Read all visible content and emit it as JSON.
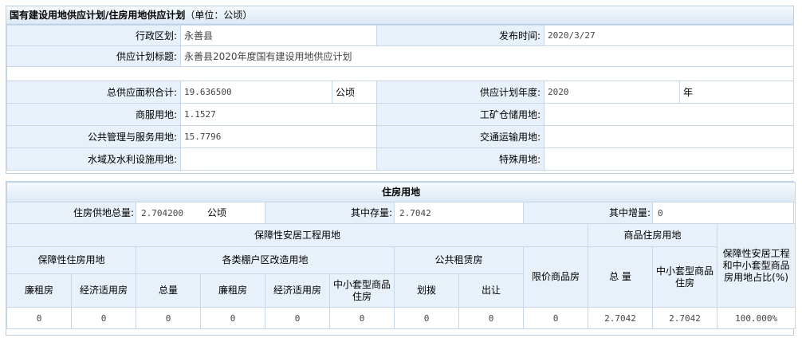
{
  "top": {
    "title": "国有建设用地供应计划/住房用地供应计划",
    "unit_note": "（单位：公顷）",
    "row1": {
      "district_label": "行政区划:",
      "district_value": "永善县",
      "pubtime_label": "发布时间:",
      "pubtime_value": "2020/3/27"
    },
    "row2": {
      "plan_title_label": "供应计划标题:",
      "plan_title_value": "永善县2020年度国有建设用地供应计划"
    },
    "row3": {
      "total_label": "总供应面积合计:",
      "total_value": "19.636500",
      "total_unit": "公顷",
      "year_label": "供应计划年度:",
      "year_value": "2020",
      "year_unit": "年"
    },
    "row4": {
      "commercial_label": "商服用地:",
      "commercial_value": "1.1527",
      "industrial_label": "工矿仓储用地:",
      "industrial_value": ""
    },
    "row5": {
      "public_label": "公共管理与服务用地:",
      "public_value": "15.7796",
      "transport_label": "交通运输用地:",
      "transport_value": ""
    },
    "row6": {
      "water_label": "水域及水利设施用地:",
      "water_value": "",
      "special_label": "特殊用地:",
      "special_value": ""
    }
  },
  "housing": {
    "title": "住房用地",
    "total_label": "住房供地总量:",
    "total_value": "2.704200",
    "total_unit": "公顷",
    "stock_label": "其中存量:",
    "stock_value": "2.7042",
    "increment_label": "其中增量:",
    "increment_value": "0",
    "h_guarantee_project": "保障性安居工程用地",
    "h_commercial_housing": "商品住房用地",
    "h_ratio": "保障性安居工程和中小套型商品房用地占比(%)",
    "h_guarantee_housing": "保障性住房用地",
    "h_shanty": "各类棚户区改造用地",
    "h_public_rental": "公共租赁房",
    "h_price_limited": "限价商品房",
    "h_low_rent": "廉租房",
    "h_affordable": "经济适用房",
    "h_total": "总量",
    "h_low_rent2": "廉租房",
    "h_affordable2": "经济适用房",
    "h_small_medium": "中小套型商品住房",
    "h_allocation": "划拨",
    "h_transfer": "出让",
    "h_com_total": "总 量",
    "h_com_small": "中小套型商品住房",
    "values": [
      "0",
      "0",
      "0",
      "0",
      "0",
      "0",
      "0",
      "0",
      "0",
      "2.7042",
      "2.7042",
      "100.000%"
    ]
  }
}
